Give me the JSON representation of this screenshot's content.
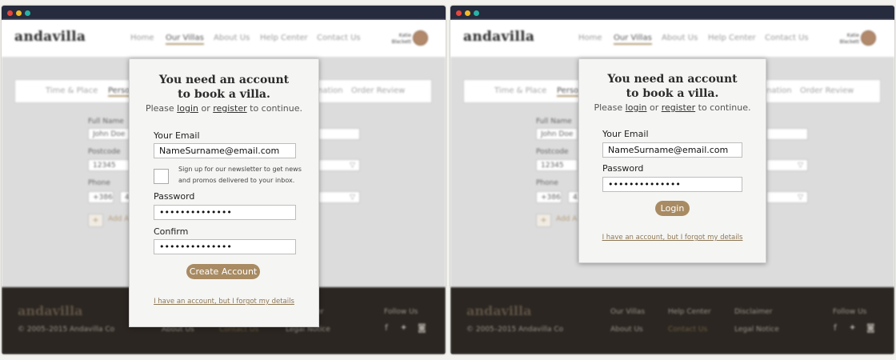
{
  "colors": {
    "accent": "#a88b63",
    "titlebar": "#262b3d",
    "footer": "#2b2621"
  },
  "site": {
    "logo": "andavilla",
    "nav": [
      "Home",
      "Our Villas",
      "About Us",
      "Help Center",
      "Contact Us"
    ],
    "nav_active": "Our Villas",
    "user_first": "Katie",
    "user_last": "Blackett",
    "steps": [
      "Time & Place",
      "Perso",
      "nation",
      "Order Review"
    ],
    "form": {
      "full_name_label": "Full Name",
      "full_name_value": "John Doe",
      "postcode_label": "Postcode",
      "postcode_value": "12345",
      "phone_label": "Phone",
      "phone_code": "+386",
      "phone_prefix": "41",
      "add_label": "Add A"
    },
    "footer": {
      "logo": "andavilla",
      "copyright": "© 2005–2015 Andavilla Co",
      "links": [
        "Our Villas",
        "Help Center",
        "Disclaimer",
        "About Us",
        "Contact Us",
        "Legal Notice"
      ],
      "follow": "Follow Us"
    }
  },
  "register_modal": {
    "title_line1": "You need an account",
    "title_line2": "to book a villa.",
    "sub_before": "Please ",
    "login_link": "login",
    "sub_or": " or ",
    "register_link": "register",
    "sub_after": " to continue.",
    "email_label": "Your Email",
    "email_value": "NameSurname@email.com",
    "newsletter_line1": "Sign up for our newsletter to get news",
    "newsletter_line2": "and promos delivered to your inbox.",
    "password_label": "Password",
    "password_value": "••••••••••••••",
    "confirm_label": "Confirm",
    "confirm_value": "••••••••••••••",
    "button": "Create Account",
    "forgot": "I have an account, but I forgot my details"
  },
  "login_modal": {
    "title_line1": "You need an account",
    "title_line2": "to book a villa.",
    "sub_before": "Please ",
    "login_link": "login",
    "sub_or": " or ",
    "register_link": "register",
    "sub_after": " to continue.",
    "email_label": "Your Email",
    "email_value": "NameSurname@email.com",
    "password_label": "Password",
    "password_value": "••••••••••••••",
    "button": "Login",
    "forgot": "I have an account, but I forgot my details"
  }
}
